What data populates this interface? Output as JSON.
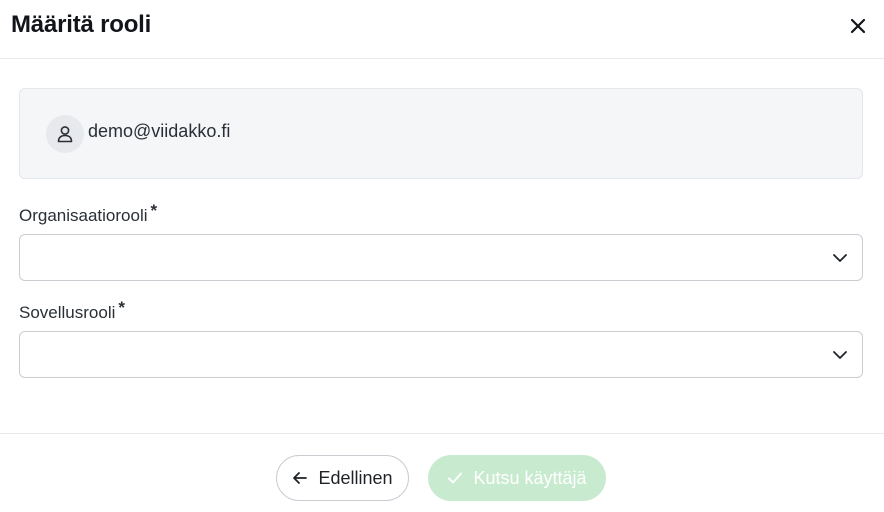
{
  "dialog": {
    "title": "Määritä rooli",
    "close_icon": "close-icon"
  },
  "user": {
    "email": "demo@viidakko.fi",
    "avatar_icon": "user-icon"
  },
  "fields": {
    "organization_role": {
      "label": "Organisaatiorooli",
      "required_mark": "*",
      "value": ""
    },
    "application_role": {
      "label": "Sovellusrooli",
      "required_mark": "*",
      "value": ""
    }
  },
  "footer": {
    "back_label": "Edellinen",
    "invite_label": "Kutsu käyttäjä"
  },
  "colors": {
    "invite_button_bg": "#c8ebd0",
    "card_bg": "#f4f6f8"
  }
}
